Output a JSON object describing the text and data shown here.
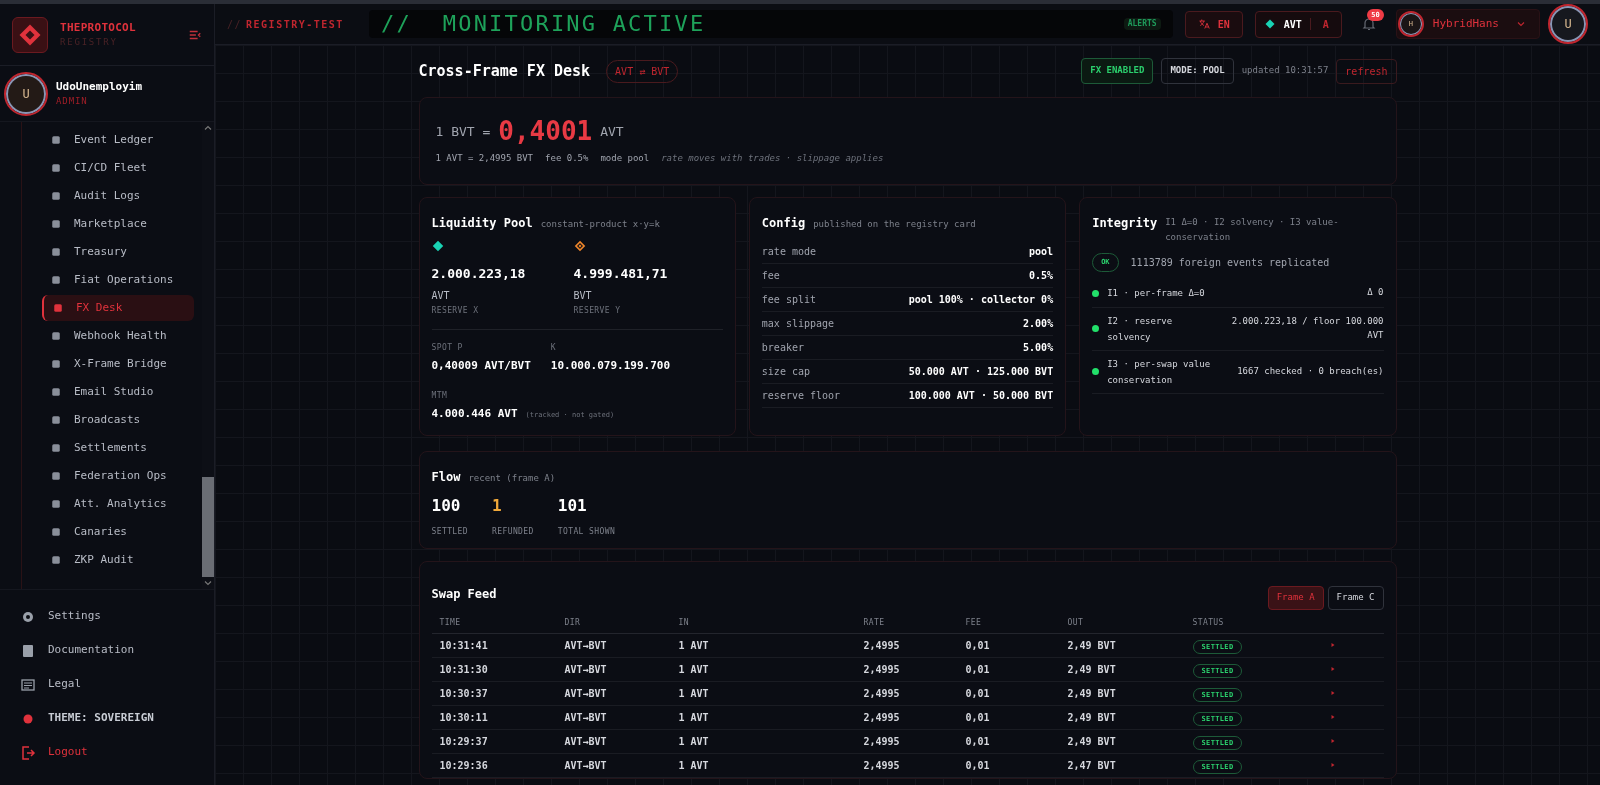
{
  "brand": {
    "name": "THEPROTOCOL",
    "sub": "REGISTRY"
  },
  "user": {
    "initial": "U",
    "name": "UdoUnemployim",
    "role": "ADMIN"
  },
  "nav": {
    "items": [
      {
        "label": "Event Ledger",
        "selected": false
      },
      {
        "label": "CI/CD Fleet",
        "selected": false
      },
      {
        "label": "Audit Logs",
        "selected": false
      },
      {
        "label": "Marketplace",
        "selected": false
      },
      {
        "label": "Treasury",
        "selected": false
      },
      {
        "label": "Fiat Operations",
        "selected": false
      },
      {
        "label": "FX Desk",
        "selected": true
      },
      {
        "label": "Webhook Health",
        "selected": false
      },
      {
        "label": "X-Frame Bridge",
        "selected": false
      },
      {
        "label": "Email Studio",
        "selected": false
      },
      {
        "label": "Broadcasts",
        "selected": false
      },
      {
        "label": "Settlements",
        "selected": false
      },
      {
        "label": "Federation Ops",
        "selected": false
      },
      {
        "label": "Att. Analytics",
        "selected": false
      },
      {
        "label": "Canaries",
        "selected": false
      },
      {
        "label": "ZKP Audit",
        "selected": false
      }
    ]
  },
  "sidebar_footer": [
    {
      "label": "Settings",
      "kind": "settings"
    },
    {
      "label": "Documentation",
      "kind": "docs"
    },
    {
      "label": "Legal",
      "kind": "legal"
    },
    {
      "label": "THEME: SOVEREIGN",
      "kind": "theme"
    },
    {
      "label": "Logout",
      "kind": "logout"
    }
  ],
  "topbar": {
    "env_prefix": "//",
    "env": "REGISTRY-TEST",
    "banner": "//  MONITORING ACTIVE",
    "alerts": "ALERTS",
    "language": "EN",
    "currency": "AVT",
    "frame": "A",
    "notifications": "50",
    "account": {
      "initial": "H",
      "name": "HybridHans"
    },
    "avatar": "U"
  },
  "header": {
    "title": "Cross-Frame FX Desk",
    "pair": "AVT ⇄ BVT",
    "fx_status": "FX ENABLED",
    "mode": "MODE: POOL",
    "updated": "updated 10:31:57",
    "refresh": "refresh"
  },
  "rate": {
    "base": "1 BVT =",
    "value": "0,4001",
    "quote": "AVT",
    "inverse": "1 AVT = 2,4995 BVT",
    "fee": "fee 0.5%",
    "mode": "mode pool",
    "note": "rate moves with trades · slippage applies"
  },
  "pool": {
    "title": "Liquidity Pool",
    "subtitle": "constant-product x·y=k",
    "reserves": [
      {
        "value": "2.000.223,18",
        "symbol": "AVT",
        "label": "RESERVE X",
        "color": "#19d3b4"
      },
      {
        "value": "4.999.481,71",
        "symbol": "BVT",
        "label": "RESERVE Y",
        "color": "#f0862a"
      }
    ],
    "spot": {
      "label": "SPOT P",
      "value": "0,40009 AVT/BVT"
    },
    "k": {
      "label": "K",
      "value": "10.000.079.199.700"
    },
    "mtm": {
      "label": "MTM",
      "value": "4.000.446 AVT",
      "note": "(tracked · not gated)"
    }
  },
  "config": {
    "title": "Config",
    "subtitle": "published on the registry card",
    "rows": [
      {
        "label": "rate mode",
        "value": "pool"
      },
      {
        "label": "fee",
        "value": "0.5%"
      },
      {
        "label": "fee split",
        "value": "pool 100% · collector 0%"
      },
      {
        "label": "max slippage",
        "value": "2.00%"
      },
      {
        "label": "breaker",
        "value": "5.00%"
      },
      {
        "label": "size cap",
        "value": "50.000 AVT · 125.000 BVT"
      },
      {
        "label": "reserve floor",
        "value": "100.000 AVT · 50.000 BVT"
      }
    ]
  },
  "integrity": {
    "title": "Integrity",
    "subtitle": "I1 Δ=0 · I2 solvency · I3 value-conservation",
    "ok_badge": "OK",
    "replicated": "1113789 foreign events replicated",
    "checks": [
      {
        "label": "I1 · per-frame Δ=0",
        "value": "Δ 0",
        "ok": true
      },
      {
        "label": "I2 · reserve solvency",
        "value": "2.000.223,18 / floor 100.000 AVT",
        "ok": true
      },
      {
        "label": "I3 · per-swap value conservation",
        "value": "1667 checked · 0 breach(es)",
        "ok": true
      }
    ]
  },
  "flow": {
    "title": "Flow",
    "subtitle": "recent (frame A)",
    "stats": [
      {
        "value": "100",
        "label": "SETTLED",
        "kind": "settled"
      },
      {
        "value": "1",
        "label": "REFUNDED",
        "kind": "refunded"
      },
      {
        "value": "101",
        "label": "TOTAL SHOWN",
        "kind": "total"
      }
    ]
  },
  "swap_feed": {
    "title": "Swap Feed",
    "frames": [
      {
        "label": "Frame A",
        "selected": true
      },
      {
        "label": "Frame C",
        "selected": false
      }
    ],
    "columns": [
      "TIME",
      "DIR",
      "IN",
      "RATE",
      "FEE",
      "OUT",
      "STATUS"
    ],
    "rows": [
      {
        "time": "10:31:41",
        "dir": "AVT→BVT",
        "in": "1 AVT",
        "rate": "2,4995",
        "fee": "0,01",
        "out": "2,49 BVT",
        "status": "SETTLED"
      },
      {
        "time": "10:31:30",
        "dir": "AVT→BVT",
        "in": "1 AVT",
        "rate": "2,4995",
        "fee": "0,01",
        "out": "2,49 BVT",
        "status": "SETTLED"
      },
      {
        "time": "10:30:37",
        "dir": "AVT→BVT",
        "in": "1 AVT",
        "rate": "2,4995",
        "fee": "0,01",
        "out": "2,49 BVT",
        "status": "SETTLED"
      },
      {
        "time": "10:30:11",
        "dir": "AVT→BVT",
        "in": "1 AVT",
        "rate": "2,4995",
        "fee": "0,01",
        "out": "2,49 BVT",
        "status": "SETTLED"
      },
      {
        "time": "10:29:37",
        "dir": "AVT→BVT",
        "in": "1 AVT",
        "rate": "2,4995",
        "fee": "0,01",
        "out": "2,49 BVT",
        "status": "SETTLED"
      },
      {
        "time": "10:29:36",
        "dir": "AVT→BVT",
        "in": "1 AVT",
        "rate": "2,4995",
        "fee": "0,01",
        "out": "2,47 BVT",
        "status": "SETTLED"
      }
    ]
  }
}
